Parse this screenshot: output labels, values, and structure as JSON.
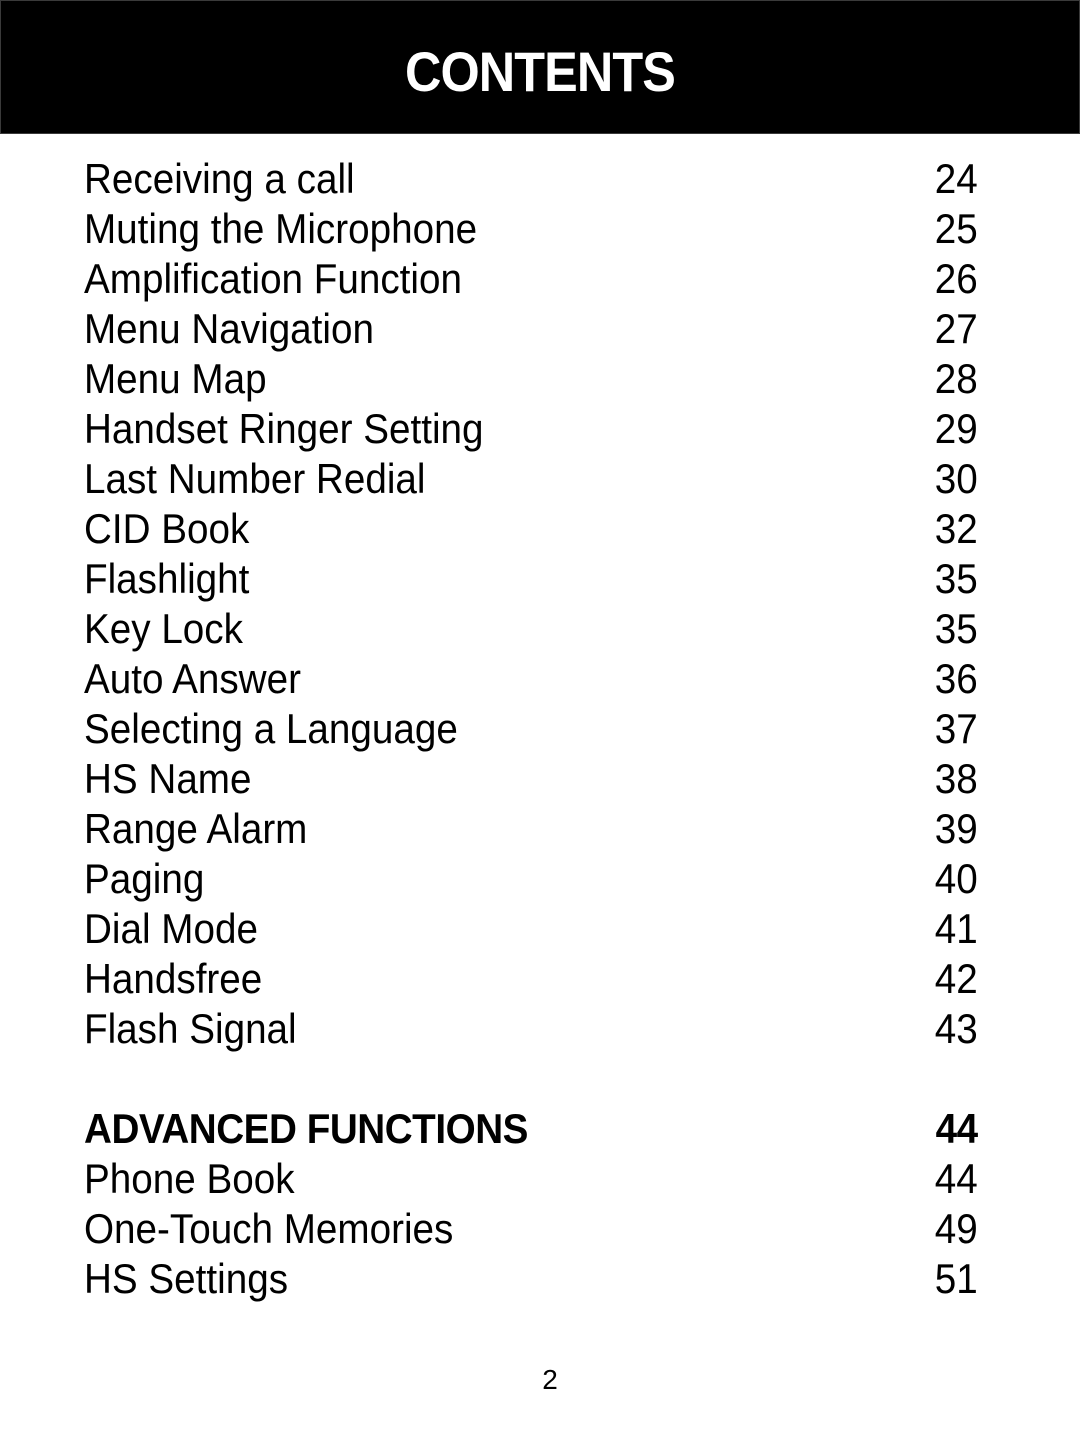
{
  "header": {
    "title": "CONTENTS"
  },
  "toc": {
    "entries": [
      {
        "label": "Receiving a call",
        "page": "24"
      },
      {
        "label": "Muting the Microphone",
        "page": "25"
      },
      {
        "label": "Amplification Function",
        "page": "26"
      },
      {
        "label": "Menu Navigation",
        "page": "27"
      },
      {
        "label": "Menu Map",
        "page": "28"
      },
      {
        "label": "Handset Ringer Setting",
        "page": "29"
      },
      {
        "label": "Last Number Redial",
        "page": "30"
      },
      {
        "label": "CID Book",
        "page": "32"
      },
      {
        "label": "Flashlight",
        "page": "35"
      },
      {
        "label": "Key Lock",
        "page": "35"
      },
      {
        "label": "Auto Answer",
        "page": "36"
      },
      {
        "label": "Selecting a Language",
        "page": "37"
      },
      {
        "label": "HS Name",
        "page": "38"
      },
      {
        "label": "Range Alarm",
        "page": "39"
      },
      {
        "label": "Paging",
        "page": "40"
      },
      {
        "label": "Dial Mode",
        "page": "41"
      },
      {
        "label": "Handsfree",
        "page": "42"
      },
      {
        "label": "Flash Signal",
        "page": "43"
      }
    ],
    "section": {
      "label": "ADVANCED FUNCTIONS",
      "page": "44",
      "entries": [
        {
          "label": "Phone Book",
          "page": "44"
        },
        {
          "label": "One-Touch Memories",
          "page": "49"
        },
        {
          "label": "HS Settings",
          "page": "51"
        }
      ]
    }
  },
  "footer": {
    "page_number": "2"
  }
}
